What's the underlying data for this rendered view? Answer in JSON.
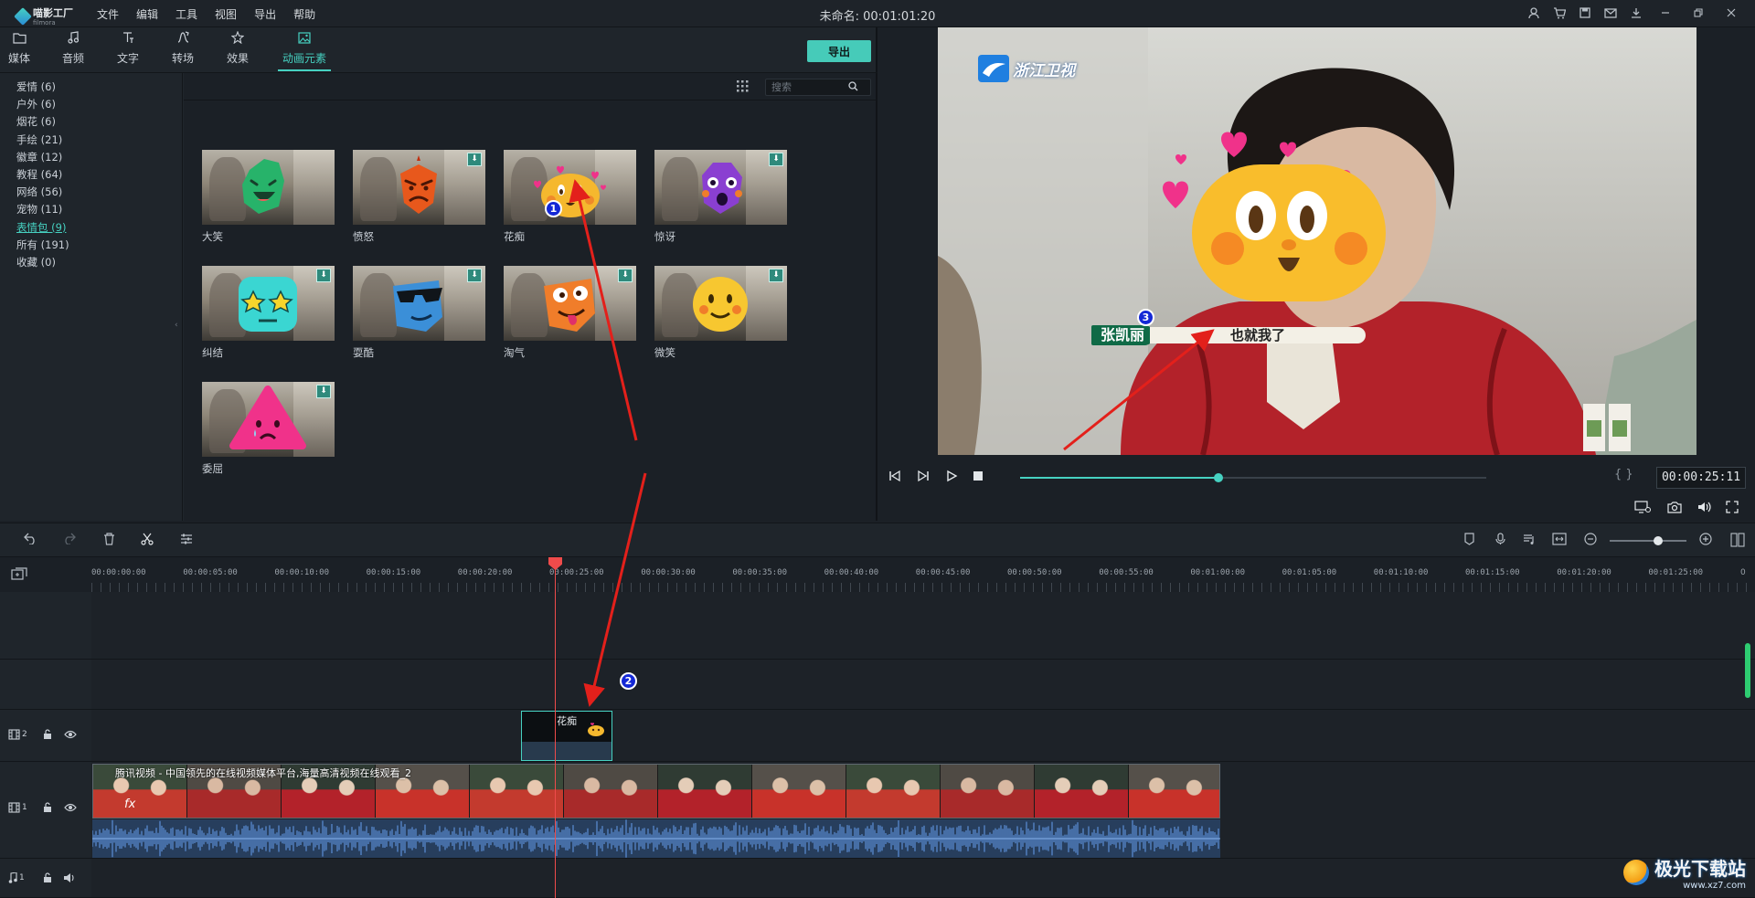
{
  "app": {
    "name": "喵影工厂",
    "sub": "filmora",
    "menu": [
      "文件",
      "编辑",
      "工具",
      "视图",
      "导出",
      "帮助"
    ],
    "window_title": "未命名: 00:01:01:20"
  },
  "tabs": [
    {
      "label": "媒体",
      "icon": "folder-icon"
    },
    {
      "label": "音频",
      "icon": "music-note-icon"
    },
    {
      "label": "文字",
      "icon": "text-icon"
    },
    {
      "label": "转场",
      "icon": "transition-icon"
    },
    {
      "label": "效果",
      "icon": "effects-icon"
    },
    {
      "label": "动画元素",
      "icon": "image-icon",
      "active": true
    }
  ],
  "export_label": "导出",
  "categories": [
    {
      "label": "爱情 (6)"
    },
    {
      "label": "户外 (6)"
    },
    {
      "label": "烟花 (6)"
    },
    {
      "label": "手绘 (21)"
    },
    {
      "label": "徽章 (12)"
    },
    {
      "label": "教程 (64)"
    },
    {
      "label": "网络 (56)"
    },
    {
      "label": "宠物 (11)"
    },
    {
      "label": "表情包 (9)",
      "active": true
    },
    {
      "label": "所有 (191)"
    },
    {
      "label": "收藏 (0)"
    }
  ],
  "search": {
    "placeholder": "搜索"
  },
  "stickers": [
    {
      "label": "大笑",
      "color": "#27b36a",
      "download": false
    },
    {
      "label": "愤怒",
      "color": "#e8581c",
      "download": true
    },
    {
      "label": "花痴",
      "color": "#f5b82e",
      "download": false
    },
    {
      "label": "惊讶",
      "color": "#8a3fd1",
      "download": true
    },
    {
      "label": "纠结",
      "color": "#3ad6d2",
      "download": true
    },
    {
      "label": "耍酷",
      "color": "#3b8fd8",
      "download": true
    },
    {
      "label": "淘气",
      "color": "#f07d2a",
      "download": true
    },
    {
      "label": "微笑",
      "color": "#f7c730",
      "download": true
    },
    {
      "label": "委屈",
      "color": "#f0328a",
      "download": true
    }
  ],
  "preview": {
    "channel_logo": "浙江卫视",
    "name_caption": "张凯丽",
    "subtitle": "也就我了",
    "timecode": "00:00:25:11",
    "progress": 0.425,
    "mark_in_out": "{ }"
  },
  "ruler": [
    "00:00:00:00",
    "00:00:05:00",
    "00:00:10:00",
    "00:00:15:00",
    "00:00:20:00",
    "00:00:25:00",
    "00:00:30:00",
    "00:00:35:00",
    "00:00:40:00",
    "00:00:45:00",
    "00:00:50:00",
    "00:00:55:00",
    "00:01:00:00",
    "00:01:05:00",
    "00:01:10:00",
    "00:01:15:00",
    "00:01:20:00",
    "00:01:25:00"
  ],
  "tracks": {
    "t2": "2",
    "t1": "1",
    "a1": "1",
    "sticker_clip_label": "花痴",
    "video_clip_title": "腾讯视频 - 中国领先的在线视频媒体平台,海量高清视频在线观看_2"
  },
  "annotations": [
    "1",
    "2",
    "3"
  ],
  "watermark": {
    "text": "极光下载站",
    "url": "www.xz7.com"
  },
  "colors": {
    "accent": "#46d1c1",
    "playhead": "#ef4b4b",
    "annotation": "#1428d6",
    "arrow": "#e3201b"
  }
}
